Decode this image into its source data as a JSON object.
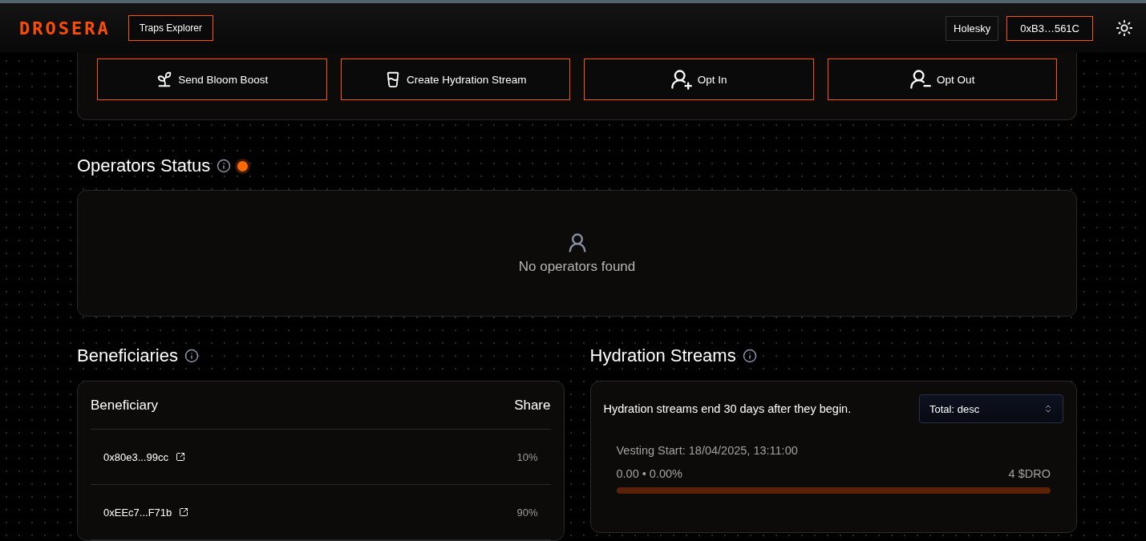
{
  "header": {
    "logo": "DROSERA",
    "nav": [
      {
        "label": "Traps Explorer"
      }
    ],
    "network": "Holesky",
    "wallet": "0xB3…561C"
  },
  "actions": [
    {
      "kind": "boost",
      "label": "Send Bloom Boost"
    },
    {
      "kind": "stream",
      "label": "Create Hydration Stream"
    },
    {
      "kind": "optin",
      "label": "Opt In"
    },
    {
      "kind": "optout",
      "label": "Opt Out"
    }
  ],
  "operators": {
    "title": "Operators Status",
    "empty": "No operators found"
  },
  "beneficiaries": {
    "title": "Beneficiaries",
    "columns": [
      "Beneficiary",
      "Share"
    ],
    "rows": [
      {
        "address": "0x80e3...99cc",
        "share": "10%"
      },
      {
        "address": "0xEEc7...F71b",
        "share": "90%"
      }
    ]
  },
  "streams": {
    "title": "Hydration Streams",
    "note": "Hydration streams end 30 days after they begin.",
    "sort": "Total: desc",
    "items": [
      {
        "start": "Vesting Start: 18/04/2025, 13:11:00",
        "progress": "0.00 • 0.00%",
        "total": "4 $DRO",
        "level": 0
      }
    ]
  }
}
